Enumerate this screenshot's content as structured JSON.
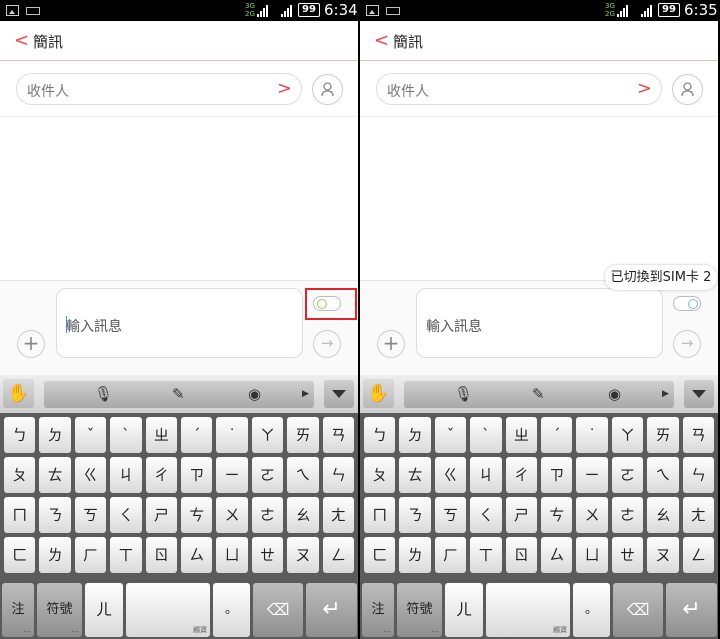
{
  "left": {
    "status": {
      "battery": "99",
      "time": "6:34",
      "net_top": "3G",
      "net_bottom": "2G"
    },
    "header": {
      "back_icon": "<",
      "title": "簡訊"
    },
    "recipient": {
      "placeholder": "收件人",
      "chevron": ">"
    },
    "compose": {
      "placeholder": "輸入訊息",
      "plus": "+",
      "send": "→",
      "sim_toggle": "sim1"
    },
    "toast": null
  },
  "right": {
    "status": {
      "battery": "99",
      "time": "6:35",
      "net_top": "3G",
      "net_bottom": "2G"
    },
    "header": {
      "back_icon": "<",
      "title": "簡訊"
    },
    "recipient": {
      "placeholder": "收件人",
      "chevron": ">"
    },
    "compose": {
      "placeholder": "輸入訊息",
      "plus": "+",
      "send": "→",
      "sim_toggle": "sim2"
    },
    "toast": "已切換到SIM卡 2"
  },
  "keyboard": {
    "toolbar_icons": [
      "gesture-icon",
      "mic-icon",
      "pencil-icon",
      "weibo-icon",
      "arrow-right-icon",
      "collapse-icon"
    ],
    "rows": [
      [
        "ㄅ",
        "ㄉ",
        "ˇ",
        "ˋ",
        "ㄓ",
        "ˊ",
        "˙",
        "ㄚ",
        "ㄞ",
        "ㄢ"
      ],
      [
        "ㄆ",
        "ㄊ",
        "ㄍ",
        "ㄐ",
        "ㄔ",
        "ㄗ",
        "ㄧ",
        "ㄛ",
        "ㄟ",
        "ㄣ"
      ],
      [
        "ㄇ",
        "ㄋ",
        "ㄎ",
        "ㄑ",
        "ㄕ",
        "ㄘ",
        "ㄨ",
        "ㄜ",
        "ㄠ",
        "ㄤ"
      ],
      [
        "ㄈ",
        "ㄌ",
        "ㄏ",
        "ㄒ",
        "ㄖ",
        "ㄙ",
        "ㄩ",
        "ㄝ",
        "ㄡ",
        "ㄥ"
      ]
    ],
    "bottom": {
      "zhu": "注",
      "symbols": "符號",
      "er": "ㄦ",
      "space_sub": "觸寶",
      "period": "。",
      "delete": "⌫",
      "enter": "↵"
    }
  },
  "colors": {
    "accent": "#e5484d",
    "highlight": "#e0232a"
  }
}
